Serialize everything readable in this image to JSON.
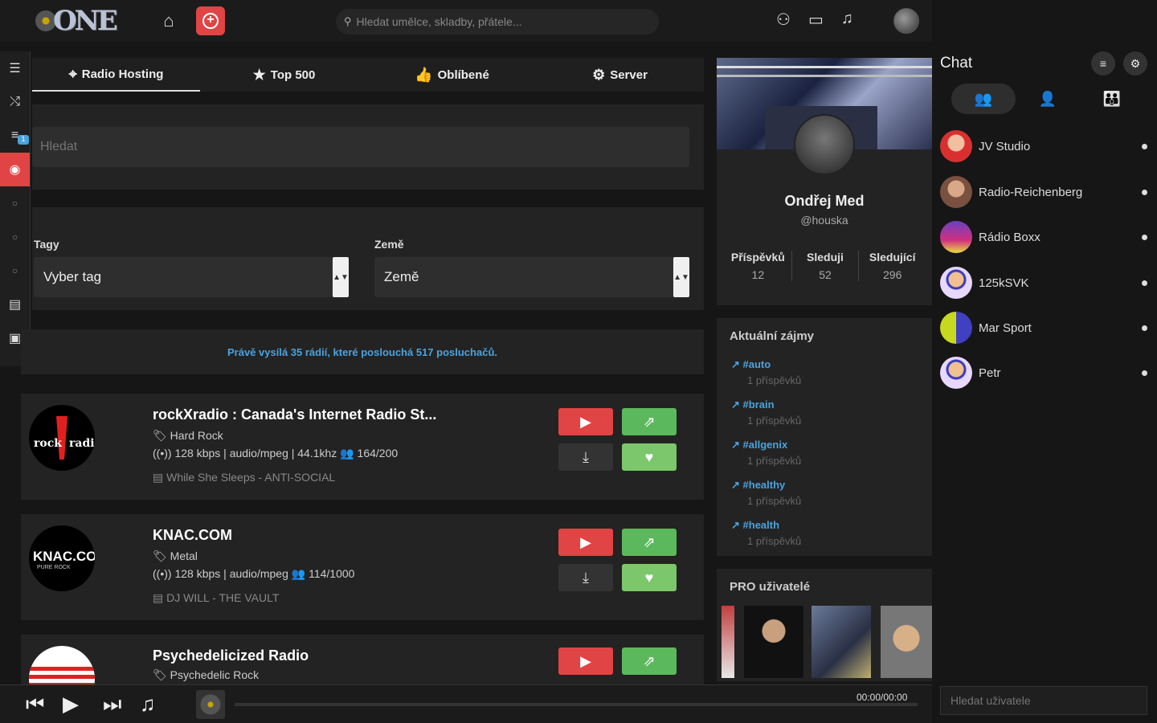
{
  "app": {
    "logo_text": "ONE"
  },
  "topbar": {
    "search_placeholder": "Hledat umělce, skladby, přátele...",
    "icons": [
      "home-icon",
      "add-circle-icon",
      "user-icon",
      "display-icon",
      "bell-icon",
      "avatar"
    ]
  },
  "sidebar": {
    "items": [
      "list-icon",
      "shuffle-icon",
      "queue-icon",
      "radio-icon",
      "circle-icon",
      "circle-icon",
      "circle-icon",
      "document-icon",
      "lock-icon"
    ],
    "queue_badge": "1"
  },
  "tabs": [
    {
      "label": "Radio Hosting",
      "icon": "antenna-icon",
      "active": true
    },
    {
      "label": "Top 500",
      "icon": "star-icon",
      "active": false
    },
    {
      "label": "Oblíbené",
      "icon": "thumbs-up-icon",
      "active": false
    },
    {
      "label": "Server",
      "icon": "server-gear-icon",
      "active": false
    }
  ],
  "search": {
    "placeholder": "Hledat"
  },
  "filters": {
    "tags_label": "Tagy",
    "tags_value": "Vyber tag",
    "country_label": "Země",
    "country_value": "Země"
  },
  "info_text": "Právě vysílá 35 rádií, které poslouchá 517 posluchačů.",
  "stations": [
    {
      "title": "rockXradio : Canada's Internet Radio St...",
      "genre": "Hard Rock",
      "tech": "128 kbps | audio/mpeg | 44.1khz",
      "listeners": "164/200",
      "now_playing": "While She Sleeps - ANTI-SOCIAL"
    },
    {
      "title": "KNAC.COM",
      "genre": "Metal",
      "tech": "128 kbps | audio/mpeg",
      "listeners": "114/1000",
      "now_playing": "DJ WILL - THE VAULT"
    },
    {
      "title": "Psychedelicized Radio",
      "genre": "Psychedelic Rock"
    }
  ],
  "profile": {
    "name": "Ondřej Med",
    "handle": "@houska",
    "stats": [
      {
        "label": "Příspěvků",
        "value": "12"
      },
      {
        "label": "Sleduji",
        "value": "52"
      },
      {
        "label": "Sledující",
        "value": "296"
      }
    ]
  },
  "trending": {
    "title": "Aktuální zájmy",
    "items": [
      {
        "tag": "#auto",
        "count": "1 příspěvků"
      },
      {
        "tag": "#brain",
        "count": "1 příspěvků"
      },
      {
        "tag": "#allgenix",
        "count": "1 příspěvků"
      },
      {
        "tag": "#healthy",
        "count": "1 příspěvků"
      },
      {
        "tag": "#health",
        "count": "1 příspěvků"
      }
    ]
  },
  "pro": {
    "title": "PRO uživatelé"
  },
  "chat": {
    "title": "Chat",
    "contacts": [
      {
        "name": "JV Studio",
        "color": "#d83030"
      },
      {
        "name": "Radio-Reichenberg",
        "color": "#7a5040"
      },
      {
        "name": "Rádio Boxx",
        "color": "#8a3ab0"
      },
      {
        "name": "125kSVK",
        "color": "#e8d8ff"
      },
      {
        "name": "Mar Sport",
        "color": "#c8d820"
      },
      {
        "name": "Petr",
        "color": "#e8d8ff"
      }
    ],
    "user_search_placeholder": "Hledat uživatele"
  },
  "player": {
    "time": "00:00/00:00"
  },
  "colors": {
    "accent": "#e04444",
    "link": "#4aa3df",
    "green": "#5cb85c"
  }
}
